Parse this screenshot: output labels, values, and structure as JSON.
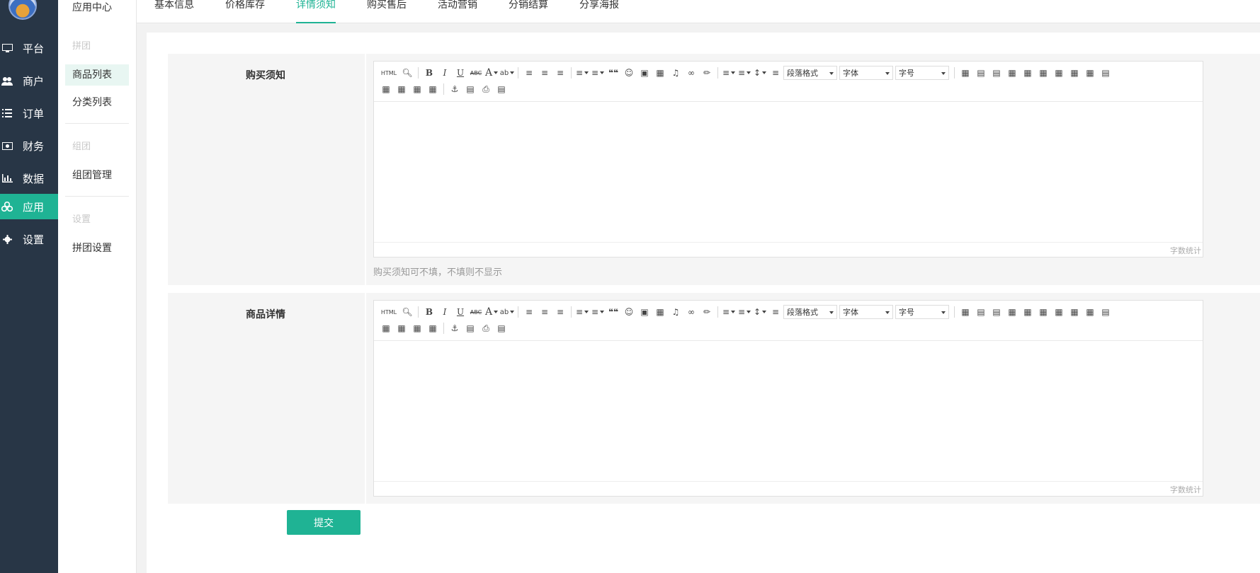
{
  "nav": [
    {
      "key": "platform",
      "label": "平台",
      "icon": "monitor-icon"
    },
    {
      "key": "merchant",
      "label": "商户",
      "icon": "users-icon"
    },
    {
      "key": "order",
      "label": "订单",
      "icon": "list-icon"
    },
    {
      "key": "finance",
      "label": "财务",
      "icon": "money-icon"
    },
    {
      "key": "data",
      "label": "数据",
      "icon": "bar-chart-icon"
    },
    {
      "key": "app",
      "label": "应用",
      "icon": "cubes-icon",
      "active": true
    },
    {
      "key": "settings",
      "label": "设置",
      "icon": "gear-icon"
    }
  ],
  "sidebar": {
    "title": "应用中心",
    "groups": [
      {
        "label": "拼团",
        "items": [
          {
            "label": "商品列表",
            "active": true
          },
          {
            "label": "分类列表"
          }
        ]
      },
      {
        "label": "组团",
        "items": [
          {
            "label": "组团管理"
          }
        ]
      },
      {
        "label": "设置",
        "items": [
          {
            "label": "拼团设置"
          }
        ]
      }
    ]
  },
  "tabs": [
    {
      "label": "基本信息"
    },
    {
      "label": "价格库存"
    },
    {
      "label": "详情须知",
      "active": true
    },
    {
      "label": "购买售后"
    },
    {
      "label": "活动营销"
    },
    {
      "label": "分销结算"
    },
    {
      "label": "分享海报"
    }
  ],
  "form": {
    "notice_label": "购买须知",
    "notice_hint": "购买须知可不填，不填则不显示",
    "detail_label": "商品详情",
    "word_count": "字数统计",
    "submit": "提交"
  },
  "editor_toolbar": {
    "paragraph_select": "段落格式",
    "font_select": "字体",
    "size_select": "字号",
    "html_button": "HTML",
    "bold": "B",
    "italic": "I",
    "underline": "U",
    "strike": "ABC",
    "font_color": "A",
    "quote": "❝❝"
  },
  "colors": {
    "accent": "#1fb394",
    "sidebar_bg": "#283646"
  }
}
